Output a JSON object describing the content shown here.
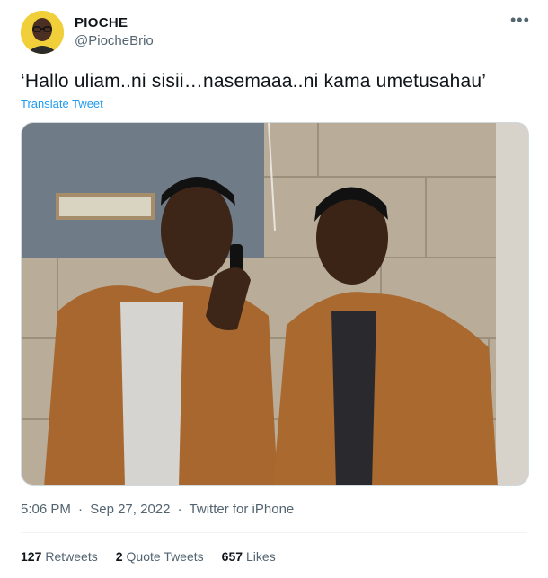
{
  "author": {
    "display_name": "PIOCHE",
    "handle": "@PiocheBrio",
    "avatar_icon": "avatar-person-glasses"
  },
  "more_icon": "more-horizontal-icon",
  "tweet": {
    "text": "‘Hallo uliam..ni sisii…nasemaaa..ni kama umetusahau’",
    "translate_label": "Translate Tweet"
  },
  "meta": {
    "time": "5:06 PM",
    "separator1": "·",
    "date": "Sep 27, 2022",
    "separator2": "·",
    "source": "Twitter for iPhone"
  },
  "stats": {
    "retweets_count": "127",
    "retweets_label": "Retweets",
    "quotes_count": "2",
    "quotes_label": "Quote Tweets",
    "likes_count": "657",
    "likes_label": "Likes"
  },
  "colors": {
    "link": "#1d9bf0",
    "secondary_text": "#536471",
    "primary_text": "#0f1419"
  }
}
